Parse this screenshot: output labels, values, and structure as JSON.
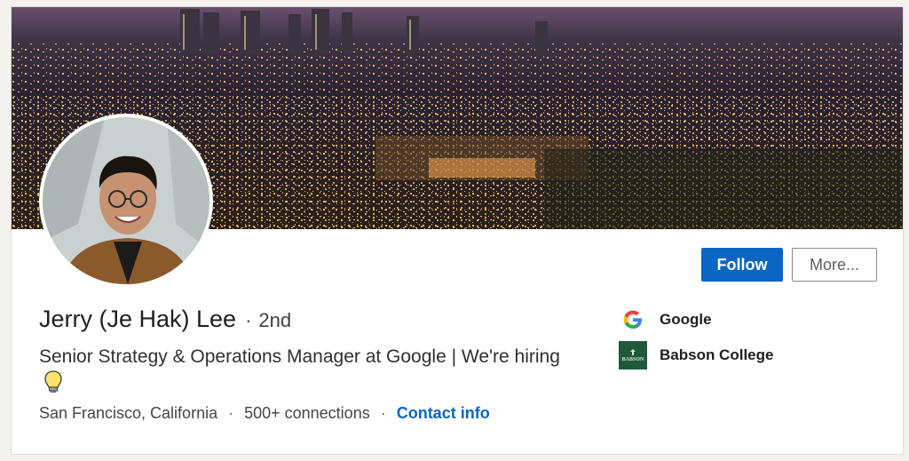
{
  "profile": {
    "name": "Jerry (Je Hak) Lee",
    "degree_separator": "·",
    "degree": "2nd",
    "headline": "Senior Strategy & Operations Manager at Google | We're hiring",
    "location": "San Francisco, California",
    "connections": "500+ connections",
    "contact_info": "Contact info",
    "meta_separator": "·"
  },
  "actions": {
    "follow_label": "Follow",
    "more_label": "More..."
  },
  "organizations": [
    {
      "name": "Google",
      "icon": "google-logo-icon"
    },
    {
      "name": "Babson College",
      "icon": "babson-college-logo-icon",
      "logo_text": "BABSON"
    }
  ],
  "colors": {
    "accent": "#0a66c2",
    "babson_green": "#1e5a3a"
  }
}
